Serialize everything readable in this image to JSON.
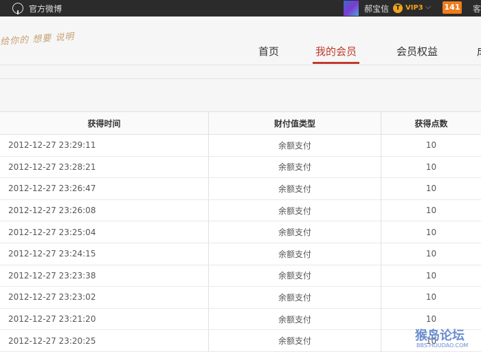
{
  "topbar": {
    "weibo_label": "官方微博",
    "username": "郝宝信",
    "vip_icon": "T",
    "vip_label": "VIP3",
    "notification_count": "141",
    "extra": "客"
  },
  "header": {
    "slogan": "给你的 想要 说明",
    "nav": [
      "首页",
      "我的会员",
      "会员权益",
      "成"
    ]
  },
  "table": {
    "headers": [
      "获得时间",
      "财付值类型",
      "获得点数"
    ],
    "rows": [
      [
        "2012-12-27 23:29:11",
        "余额支付",
        "10"
      ],
      [
        "2012-12-27 23:28:21",
        "余额支付",
        "10"
      ],
      [
        "2012-12-27 23:26:47",
        "余额支付",
        "10"
      ],
      [
        "2012-12-27 23:26:08",
        "余额支付",
        "10"
      ],
      [
        "2012-12-27 23:25:04",
        "余额支付",
        "10"
      ],
      [
        "2012-12-27 23:24:15",
        "余额支付",
        "10"
      ],
      [
        "2012-12-27 23:23:38",
        "余额支付",
        "10"
      ],
      [
        "2012-12-27 23:23:02",
        "余额支付",
        "10"
      ],
      [
        "2012-12-27 23:21:20",
        "余额支付",
        "10"
      ],
      [
        "2012-12-27 23:20:25",
        "余额支付",
        "10"
      ]
    ]
  },
  "watermark": {
    "title": "猴岛论坛",
    "url": "BBS.HOUDAO.COM"
  }
}
